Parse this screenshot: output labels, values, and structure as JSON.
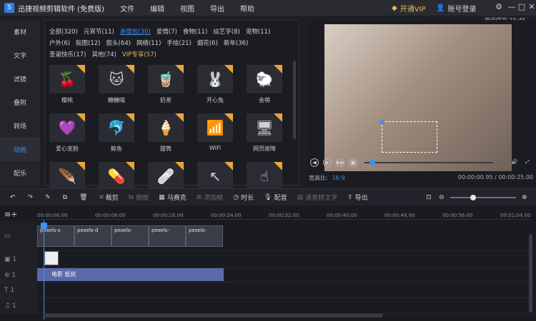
{
  "app": {
    "title": "迅捷视频剪辑软件 (免费版)",
    "logo_text": "S"
  },
  "menu": [
    "文件",
    "编辑",
    "视图",
    "导出",
    "帮助"
  ],
  "header": {
    "vip": "开通VIP",
    "login": "账号登录",
    "autosave": "最近保存 15:45"
  },
  "window_buttons": {
    "min": "—",
    "max": "□",
    "close": "✕",
    "settings": "⚙"
  },
  "nav": [
    "素材",
    "文字",
    "滤镜",
    "叠附",
    "转场",
    "动画",
    "配乐"
  ],
  "nav_active": "动画",
  "tags": [
    {
      "label": "全部(320)"
    },
    {
      "label": "元宵节(11)"
    },
    {
      "label": "表情包(30)",
      "active": true
    },
    {
      "label": "爱情(7)"
    },
    {
      "label": "食物(11)"
    },
    {
      "label": "综艺字(8)"
    },
    {
      "label": "宠物(11)"
    },
    {
      "label": "户外(6)"
    },
    {
      "label": "贴图(12)"
    },
    {
      "label": "箭头(64)"
    },
    {
      "label": "网络(11)"
    },
    {
      "label": "手绘(21)"
    },
    {
      "label": "烟花(6)"
    },
    {
      "label": "新年(36)"
    },
    {
      "label": "圣诞快乐(17)"
    },
    {
      "label": "其他(74)"
    },
    {
      "label": "VIP专享(57)",
      "vip": true
    }
  ],
  "items": [
    {
      "label": "樱桃",
      "glyph": "🍒"
    },
    {
      "label": "糖糖喵",
      "glyph": "🐱"
    },
    {
      "label": "奶茶",
      "glyph": "🧋"
    },
    {
      "label": "开心兔",
      "glyph": "🐰"
    },
    {
      "label": "会萌",
      "glyph": "🐑"
    },
    {
      "label": "爱心变脸",
      "glyph": "💜"
    },
    {
      "label": "鲸鱼",
      "glyph": "🐬"
    },
    {
      "label": "甜筒",
      "glyph": "🍦"
    },
    {
      "label": "WiFi",
      "glyph": "📶"
    },
    {
      "label": "网页故障",
      "glyph": "🖥"
    },
    {
      "label": "",
      "glyph": "🪶"
    },
    {
      "label": "",
      "glyph": "💊"
    },
    {
      "label": "",
      "glyph": "🩹"
    },
    {
      "label": "",
      "glyph": "↖"
    },
    {
      "label": "",
      "glyph": "☝"
    }
  ],
  "preview": {
    "ratio_label": "宽高比:",
    "ratio_value": "16:9",
    "time": "00:00:00.95 / 00:00:25.00",
    "controls": [
      "◀",
      "▶",
      "▶▶",
      "■"
    ],
    "progress": 0.038
  },
  "toolbar": [
    {
      "label": "",
      "icon": "↶"
    },
    {
      "label": "",
      "icon": "↷"
    },
    {
      "label": "",
      "icon": "✎"
    },
    {
      "label": "",
      "icon": "⧉"
    },
    {
      "label": "",
      "icon": "🗑"
    },
    {
      "label": "裁剪",
      "icon": "⌗"
    },
    {
      "label": "倒放",
      "icon": "⇆",
      "dim": true
    },
    {
      "label": "马赛克",
      "icon": "▦"
    },
    {
      "label": "添加帧",
      "icon": "⊞",
      "dim": true
    },
    {
      "label": "时长",
      "icon": "◷"
    },
    {
      "label": "配音",
      "icon": "🎙"
    },
    {
      "label": "语音转文字",
      "icon": "▤",
      "dim": true
    },
    {
      "label": "导出",
      "icon": "⇪"
    }
  ],
  "ruler": [
    "00:00:00.00",
    "00:00:08.00",
    "00:00:16.00",
    "00:00:24.00",
    "00:00:32.00",
    "00:00:40.00",
    "00:00:48.00",
    "00:00:56.00",
    "00:01:04.00"
  ],
  "clips": [
    "pexels-s",
    "pexels-d",
    "pexels-",
    "pexels-",
    "pexels-"
  ],
  "subtitle_clip": "电影 抵抗"
}
